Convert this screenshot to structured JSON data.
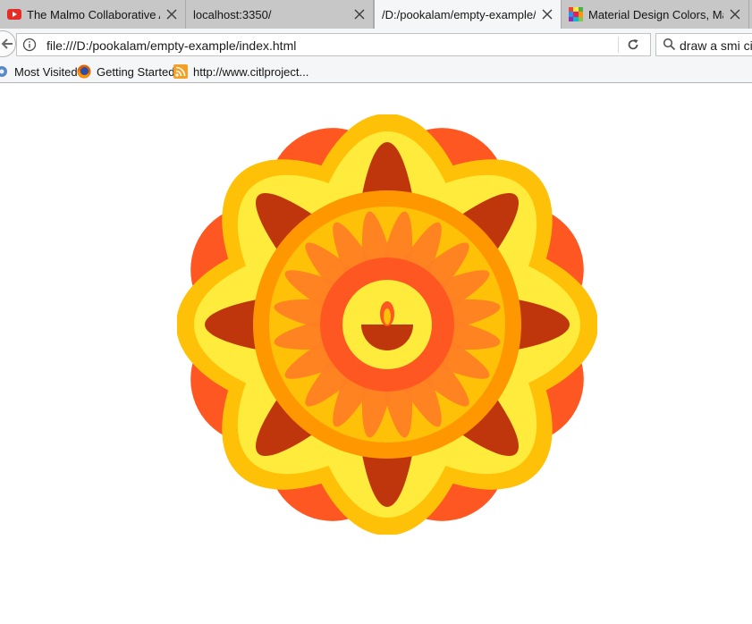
{
  "tabs": [
    {
      "title": "The Malmo Collaborative AI Challenge",
      "favicon": "youtube-icon",
      "active": false
    },
    {
      "title": "localhost:3350/",
      "favicon": "none",
      "active": false
    },
    {
      "title": "/D:/pookalam/empty-example/index.html",
      "favicon": "none",
      "active": true
    },
    {
      "title": "Material Design Colors, Material Colors",
      "favicon": "material-colors-icon",
      "active": false
    }
  ],
  "navbar": {
    "url": "file:///D:/pookalam/empty-example/index.html",
    "search_value": "draw a smi circle"
  },
  "bookmarks": [
    {
      "label": "Most Visited",
      "icon": "gear-icon"
    },
    {
      "label": "Getting Started",
      "icon": "firefox-icon"
    },
    {
      "label": "http://www.citlproject...",
      "icon": "rss-icon"
    }
  ],
  "artwork": {
    "name": "pookalam",
    "colors": {
      "outer_petals": "#ff5722",
      "gold_ring": "#ffc107",
      "yellow_fill": "#ffeb3b",
      "dark_leaves": "#bf360c",
      "orange_ring": "#ff9800",
      "amber_fill": "#ffc107",
      "inner_petals": "#ff7f24",
      "red_ring": "#ff5722",
      "center": "#ffeb3b",
      "lamp_bowl": "#bf360c",
      "flame": "#ff5722"
    }
  }
}
